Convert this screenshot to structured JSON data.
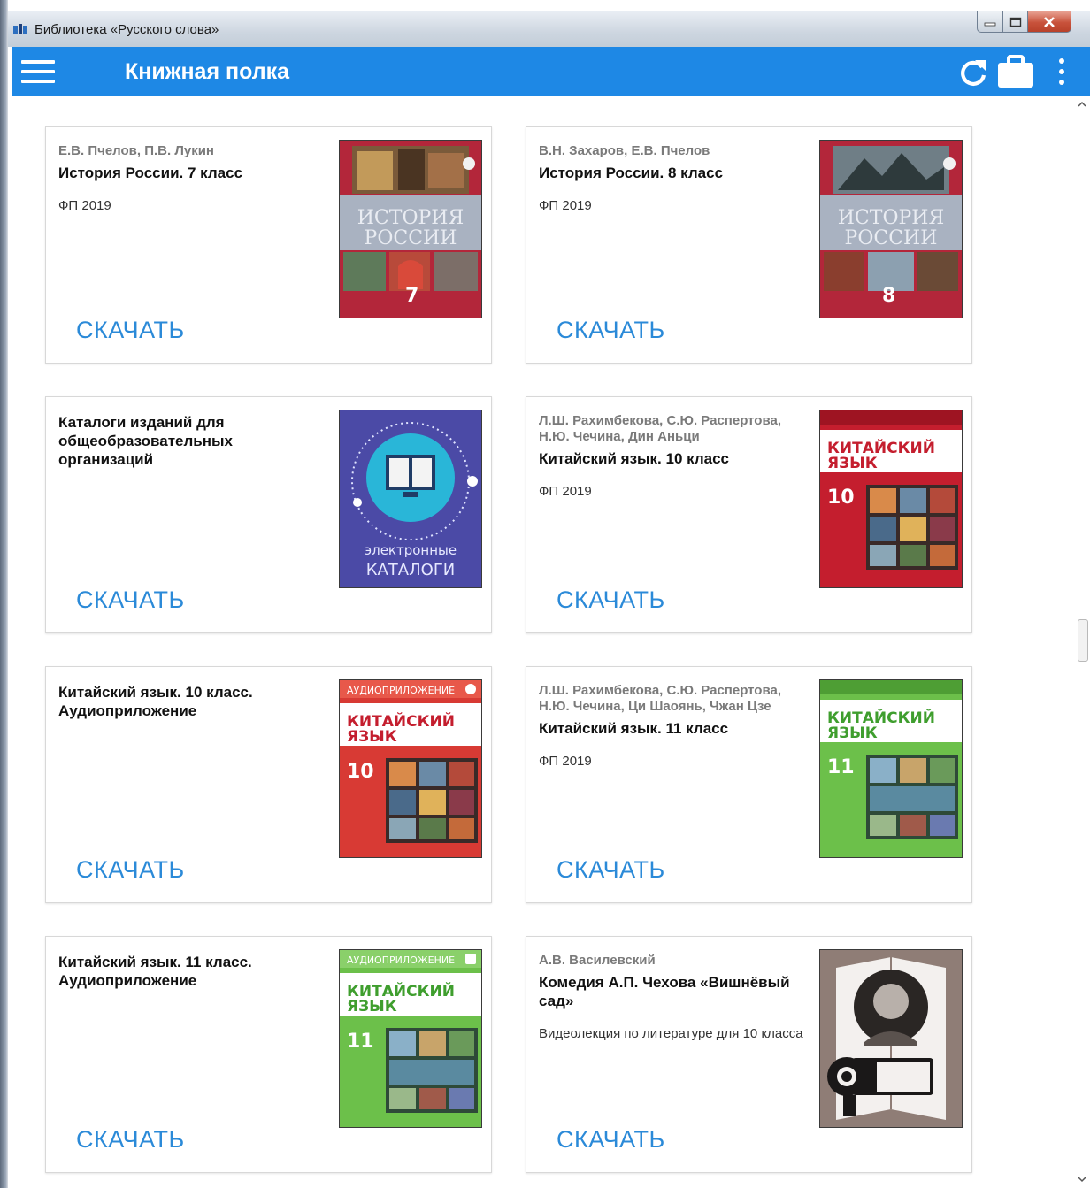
{
  "window": {
    "title": "Библиотека «Русского слова»"
  },
  "appbar": {
    "title": "Книжная полка"
  },
  "colors": {
    "appbar": "#1e88e5",
    "download": "#2b8ad8"
  },
  "books": [
    {
      "authors": "Е.В. Пчелов, П.В. Лукин",
      "title": "История России. 7 класс",
      "meta": "ФП 2019",
      "download": "СКАЧАТЬ",
      "cover": {
        "line1": "ИСТОРИЯ",
        "line2": "РОССИИ",
        "number": "7"
      }
    },
    {
      "authors": "В.Н. Захаров, Е.В. Пчелов",
      "title": "История России. 8 класс",
      "meta": "ФП 2019",
      "download": "СКАЧАТЬ",
      "cover": {
        "line1": "ИСТОРИЯ",
        "line2": "РОССИИ",
        "number": "8"
      }
    },
    {
      "authors": "",
      "title": "Каталоги изданий для общеобразовательных организаций",
      "meta": "",
      "download": "СКАЧАТЬ",
      "cover": {
        "line1": "электронные",
        "line2": "КАТАЛОГИ"
      }
    },
    {
      "authors": "Л.Ш. Рахимбекова, С.Ю. Распертова, Н.Ю. Чечина, Дин Аньци",
      "title": "Китайский язык. 10 класс",
      "meta": "ФП 2019",
      "download": "СКАЧАТЬ",
      "cover": {
        "line1": "КИТАЙСКИЙ",
        "line2": "ЯЗЫК",
        "number": "10"
      }
    },
    {
      "authors": "",
      "title": "Китайский язык. 10 класс. Аудиоприложение",
      "meta": "",
      "download": "СКАЧАТЬ",
      "cover": {
        "banner": "АУДИОПРИЛОЖЕНИЕ",
        "line1": "КИТАЙСКИЙ",
        "line2": "ЯЗЫК",
        "number": "10"
      }
    },
    {
      "authors": "Л.Ш. Рахимбекова, С.Ю. Распертова, Н.Ю. Чечина, Ци Шаоянь, Чжан Цзе",
      "title": "Китайский язык. 11 класс",
      "meta": "ФП 2019",
      "download": "СКАЧАТЬ",
      "cover": {
        "line1": "КИТАЙСКИЙ",
        "line2": "ЯЗЫК",
        "number": "11"
      }
    },
    {
      "authors": "",
      "title": "Китайский язык. 11 класс. Аудиоприложение",
      "meta": "",
      "download": "СКАЧАТЬ",
      "cover": {
        "banner": "АУДИОПРИЛОЖЕНИЕ",
        "line1": "КИТАЙСКИЙ",
        "line2": "ЯЗЫК",
        "number": "11"
      }
    },
    {
      "authors": "А.В. Василевский",
      "title": "Комедия А.П. Чехова «Вишнёвый сад»",
      "meta": "Видеолекция по литературе для 10 класса",
      "download": "СКАЧАТЬ",
      "cover": {}
    }
  ]
}
